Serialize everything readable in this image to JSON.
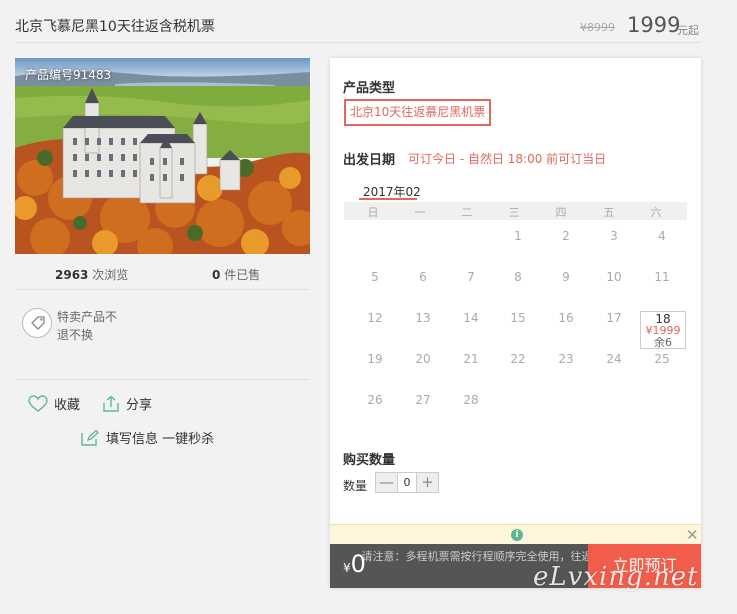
{
  "header": {
    "title": "北京飞慕尼黑10天往返含税机票",
    "original_price": "¥8999",
    "price": "1999",
    "price_suffix": "元起"
  },
  "product": {
    "code_label": "产品编号91483",
    "views_count": "2963",
    "views_label": "次浏览",
    "sold_count": "0",
    "sold_label": "件已售",
    "special_tag_text": "特卖产品不退不换"
  },
  "actions": {
    "favorite": "收藏",
    "share": "分享",
    "quick_fill": "填写信息 一键秒杀"
  },
  "booking": {
    "product_type_label": "产品类型",
    "product_type_option": "北京10天往返慕尼黑机票",
    "departure_label": "出发日期",
    "departure_note": "可订今日 - 自然日 18:00 前可订当日",
    "calendar": {
      "month": "2017年02",
      "weekdays": [
        "日",
        "一",
        "二",
        "三",
        "四",
        "五",
        "六"
      ],
      "rows": [
        [
          "",
          "",
          "",
          "1",
          "2",
          "3",
          "4"
        ],
        [
          "5",
          "6",
          "7",
          "8",
          "9",
          "10",
          "11"
        ],
        [
          "12",
          "13",
          "14",
          "15",
          "16",
          "17",
          "18"
        ],
        [
          "19",
          "20",
          "21",
          "22",
          "23",
          "24",
          "25"
        ],
        [
          "26",
          "27",
          "28",
          "",
          "",
          "",
          ""
        ]
      ],
      "selected_day": "18",
      "selected_price": "¥1999",
      "selected_stock": "余6"
    },
    "quantity_label": "购买数量",
    "quantity_field_label": "数量",
    "quantity_value": "0",
    "minus": "—",
    "plus": "+"
  },
  "footer": {
    "currency": "¥",
    "total": "0",
    "notice": "请注意：多程机票需按行程顺序完全使用，往返程不可只使用回程",
    "book_button": "立即预订"
  },
  "watermark": "eLvxing.net",
  "colors": {
    "accent": "#e0675a",
    "book": "#f15d4a",
    "green": "#5cb893"
  }
}
